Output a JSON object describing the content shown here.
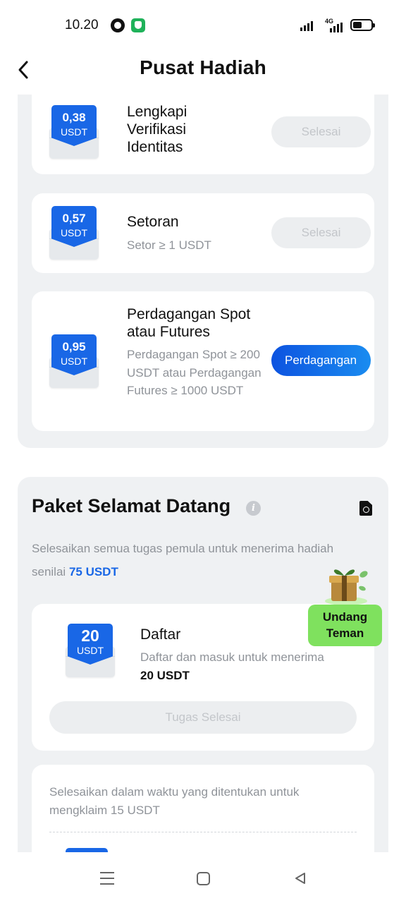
{
  "status_bar": {
    "time": "10.20",
    "network": "4G"
  },
  "header": {
    "title": "Pusat Hadiah"
  },
  "tasks": [
    {
      "amount": "0,38",
      "unit": "USDT",
      "title": "Lengkapi Verifikasi Identitas",
      "desc": "",
      "button": "Selesai",
      "button_state": "done"
    },
    {
      "amount": "0,57",
      "unit": "USDT",
      "title": "Setoran",
      "desc": "Setor ≥ 1 USDT",
      "button": "Selesai",
      "button_state": "done"
    },
    {
      "amount": "0,95",
      "unit": "USDT",
      "title": "Perdagangan Spot atau Futures",
      "desc": "Perdagangan Spot ≥ 200 USDT atau Perdagangan Futures ≥ 1000 USDT",
      "button": "Perdagangan",
      "button_state": "active"
    }
  ],
  "welcome": {
    "title": "Paket Selamat Datang",
    "desc": "Selesaikan semua tugas pemula untuk menerima hadiah senilai",
    "desc_highlight": "75 USDT",
    "invite_badge": "Undang Teman",
    "register": {
      "amount": "20",
      "unit": "USDT",
      "title": "Daftar",
      "desc": "Daftar dan masuk untuk menerima",
      "desc_bold": "20 USDT",
      "button": "Tugas Selesai"
    },
    "timed": {
      "desc": "Selesaikan dalam waktu yang ditentukan untuk mengklaim 15 USDT"
    }
  },
  "colors": {
    "accent": "#1967e6",
    "invite_green": "#7fe15e",
    "panel_bg": "#eff1f3",
    "muted_text": "#8f9399"
  }
}
